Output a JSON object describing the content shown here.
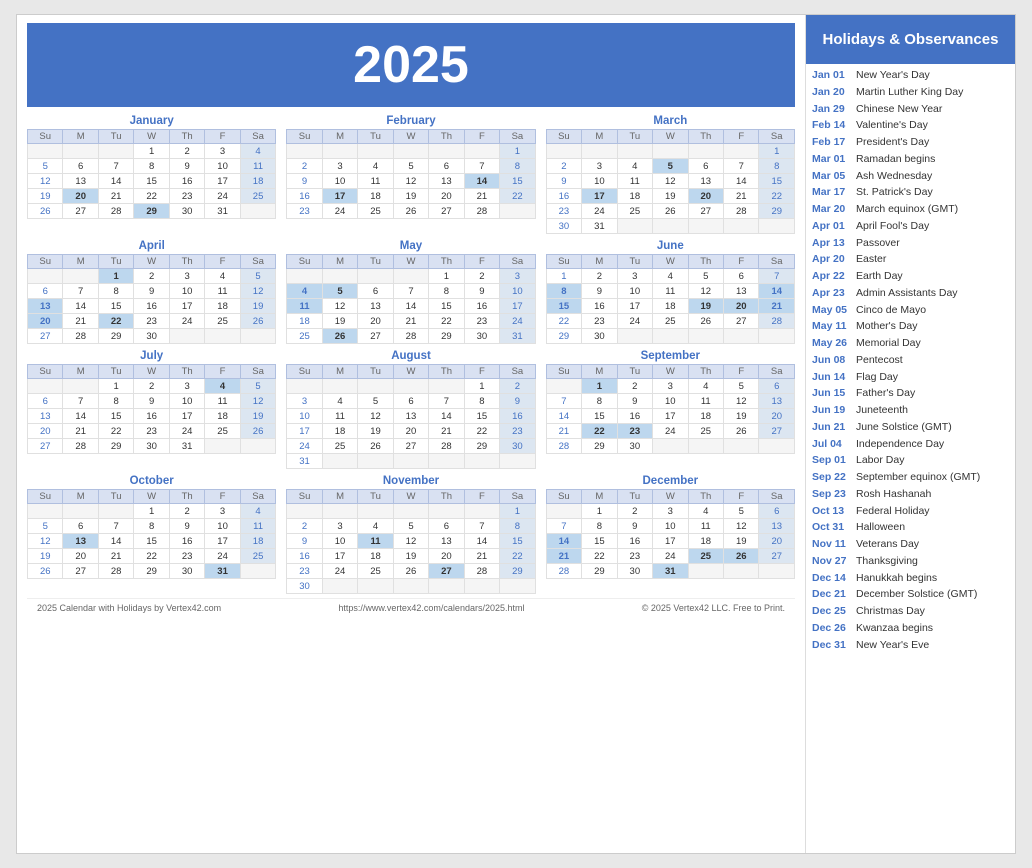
{
  "year": "2025",
  "title": "Holidays & Observances",
  "holidays": [
    {
      "date": "Jan 01",
      "name": "New Year's Day"
    },
    {
      "date": "Jan 20",
      "name": "Martin Luther King Day"
    },
    {
      "date": "Jan 29",
      "name": "Chinese New Year"
    },
    {
      "date": "Feb 14",
      "name": "Valentine's Day"
    },
    {
      "date": "Feb 17",
      "name": "President's Day"
    },
    {
      "date": "Mar 01",
      "name": "Ramadan begins"
    },
    {
      "date": "Mar 05",
      "name": "Ash Wednesday"
    },
    {
      "date": "Mar 17",
      "name": "St. Patrick's Day"
    },
    {
      "date": "Mar 20",
      "name": "March equinox (GMT)"
    },
    {
      "date": "Apr 01",
      "name": "April Fool's Day"
    },
    {
      "date": "Apr 13",
      "name": "Passover"
    },
    {
      "date": "Apr 20",
      "name": "Easter"
    },
    {
      "date": "Apr 22",
      "name": "Earth Day"
    },
    {
      "date": "Apr 23",
      "name": "Admin Assistants Day"
    },
    {
      "date": "May 05",
      "name": "Cinco de Mayo"
    },
    {
      "date": "May 11",
      "name": "Mother's Day"
    },
    {
      "date": "May 26",
      "name": "Memorial Day"
    },
    {
      "date": "Jun 08",
      "name": "Pentecost"
    },
    {
      "date": "Jun 14",
      "name": "Flag Day"
    },
    {
      "date": "Jun 15",
      "name": "Father's Day"
    },
    {
      "date": "Jun 19",
      "name": "Juneteenth"
    },
    {
      "date": "Jun 21",
      "name": "June Solstice (GMT)"
    },
    {
      "date": "Jul 04",
      "name": "Independence Day"
    },
    {
      "date": "Sep 01",
      "name": "Labor Day"
    },
    {
      "date": "Sep 22",
      "name": "September equinox (GMT)"
    },
    {
      "date": "Sep 23",
      "name": "Rosh Hashanah"
    },
    {
      "date": "Oct 13",
      "name": "Federal Holiday"
    },
    {
      "date": "Oct 31",
      "name": "Halloween"
    },
    {
      "date": "Nov 11",
      "name": "Veterans Day"
    },
    {
      "date": "Nov 27",
      "name": "Thanksgiving"
    },
    {
      "date": "Dec 14",
      "name": "Hanukkah begins"
    },
    {
      "date": "Dec 21",
      "name": "December Solstice (GMT)"
    },
    {
      "date": "Dec 25",
      "name": "Christmas Day"
    },
    {
      "date": "Dec 26",
      "name": "Kwanzaa begins"
    },
    {
      "date": "Dec 31",
      "name": "New Year's Eve"
    }
  ],
  "footer_left": "2025 Calendar with Holidays by Vertex42.com",
  "footer_center": "https://www.vertex42.com/calendars/2025.html",
  "footer_right": "© 2025 Vertex42 LLC. Free to Print."
}
